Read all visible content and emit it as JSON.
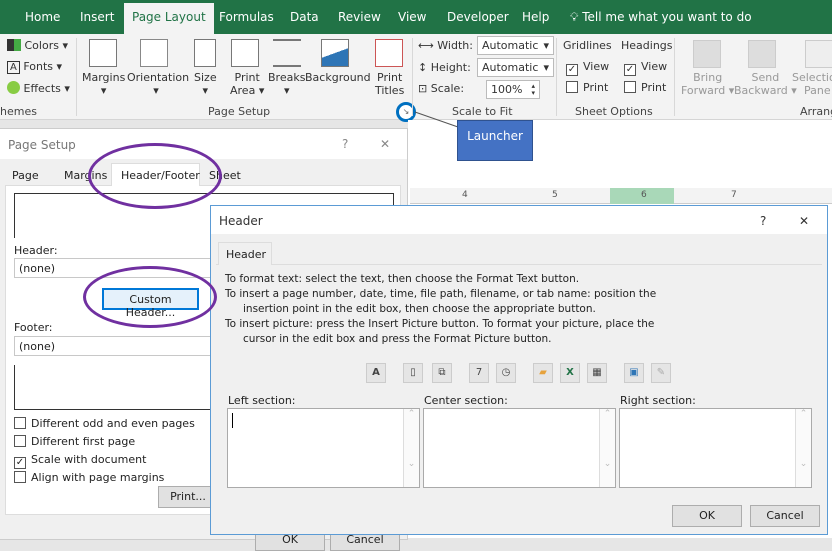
{
  "ribbon": {
    "tabs": [
      "Home",
      "Insert",
      "Page Layout",
      "Formulas",
      "Data",
      "Review",
      "View",
      "Developer",
      "Help"
    ],
    "active_tab": "Page Layout",
    "tell_me": "Tell me what you want to do",
    "themes": {
      "colors": "Colors",
      "fonts": "Fonts",
      "effects": "Effects",
      "group": "hemes"
    },
    "page_setup": {
      "margins": "Margins",
      "orientation": "Orientation",
      "size": "Size",
      "print_area_1": "Print",
      "print_area_2": "Area",
      "breaks": "Breaks",
      "background": "Background",
      "print_titles_1": "Print",
      "print_titles_2": "Titles",
      "group": "Page Setup"
    },
    "scale_to_fit": {
      "width_label": "Width:",
      "width_value": "Automatic",
      "height_label": "Height:",
      "height_value": "Automatic",
      "scale_label": "Scale:",
      "scale_value": "100%",
      "group": "Scale to Fit"
    },
    "sheet_options": {
      "gridlines": "Gridlines",
      "headings": "Headings",
      "view": "View",
      "print": "Print",
      "group": "Sheet Options",
      "gridlines_view": true,
      "gridlines_print": false,
      "headings_view": true,
      "headings_print": false
    },
    "arrange": {
      "bring_1": "Bring",
      "bring_2": "Forward",
      "send_1": "Send",
      "send_2": "Backward",
      "sel_1": "Selection",
      "sel_2": "Pane",
      "group": "Arrange"
    }
  },
  "callout": "Launcher",
  "ruler": [
    "4",
    "5",
    "6",
    "7"
  ],
  "page_setup_dialog": {
    "title": "Page Setup",
    "help": "?",
    "close": "✕",
    "tabs": [
      "Page",
      "Margins",
      "Header/Footer",
      "Sheet"
    ],
    "active_tab": "Header/Footer",
    "header_label": "Header:",
    "header_value": "(none)",
    "custom_header": "Custom Header...",
    "footer_label": "Footer:",
    "footer_value": "(none)",
    "options": [
      {
        "label": "Different odd and even pages",
        "checked": false
      },
      {
        "label": "Different first page",
        "checked": false
      },
      {
        "label": "Scale with document",
        "checked": true
      },
      {
        "label": "Align with page margins",
        "checked": false
      }
    ],
    "print": "Print...",
    "ok": "OK",
    "cancel": "Cancel"
  },
  "header_dialog": {
    "title": "Header",
    "help": "?",
    "close": "✕",
    "tab": "Header",
    "instructions": [
      "To format text:  select the text, then choose the Format Text button.",
      "To insert a page number, date, time, file path, filename, or tab name:  position the",
      "insertion point in the edit box, then choose the appropriate button.",
      "To insert picture: press the Insert Picture button.  To format your picture, place the",
      "cursor in the edit box and press the Format Picture button."
    ],
    "toolbar_icons": [
      "format-text-icon",
      "page-number-icon",
      "number-of-pages-icon",
      "date-icon",
      "time-icon",
      "file-path-icon",
      "file-name-icon",
      "sheet-name-icon",
      "insert-picture-icon",
      "format-picture-icon"
    ],
    "left_section": "Left section:",
    "center_section": "Center section:",
    "right_section": "Right section:",
    "ok": "OK",
    "cancel": "Cancel"
  },
  "colors": {
    "ribbon_green": "#217346",
    "annotation_purple": "#7030a0",
    "callout_blue": "#4472c4",
    "launcher_circle": "#0070c0"
  }
}
